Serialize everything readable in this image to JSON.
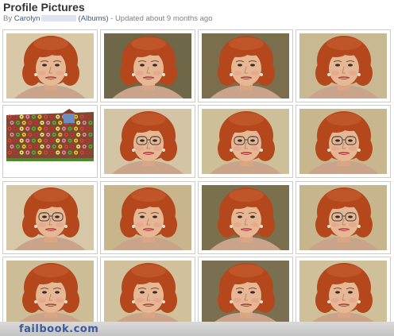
{
  "header": {
    "title": "Profile Pictures",
    "by_prefix": "By",
    "author": "Carolyn",
    "albums_link": "(Albums)",
    "updated": "- Updated about 9 months ago"
  },
  "photos": [
    {
      "kind": "portrait",
      "glasses": false,
      "bg": "#d8c8a8"
    },
    {
      "kind": "portrait",
      "glasses": false,
      "bg": "#6e6748"
    },
    {
      "kind": "portrait",
      "glasses": false,
      "bg": "#7a6e4c"
    },
    {
      "kind": "portrait",
      "glasses": false,
      "bg": "#c9b993"
    },
    {
      "kind": "farm"
    },
    {
      "kind": "portrait",
      "glasses": true,
      "bg": "#d2c4a4"
    },
    {
      "kind": "portrait",
      "glasses": true,
      "bg": "#cdbf98"
    },
    {
      "kind": "portrait",
      "glasses": true,
      "bg": "#c8b68e"
    },
    {
      "kind": "portrait",
      "glasses": true,
      "bg": "#d6c8a6"
    },
    {
      "kind": "portrait",
      "glasses": false,
      "bg": "#c9b58c"
    },
    {
      "kind": "portrait",
      "glasses": false,
      "bg": "#7b704e"
    },
    {
      "kind": "portrait",
      "glasses": true,
      "bg": "#c7b58d"
    },
    {
      "kind": "portrait",
      "glasses": false,
      "bg": "#cdbd96"
    },
    {
      "kind": "portrait",
      "glasses": false,
      "bg": "#d0c09b"
    },
    {
      "kind": "portrait",
      "glasses": false,
      "bg": "#7a6f50"
    },
    {
      "kind": "portrait",
      "glasses": false,
      "bg": "#cfc09a"
    }
  ],
  "watermark": "failbook.com",
  "colors": {
    "link": "#3b5998",
    "hair": "#b4481c",
    "skin": "#e6b795",
    "lips": "#b03a3a"
  }
}
